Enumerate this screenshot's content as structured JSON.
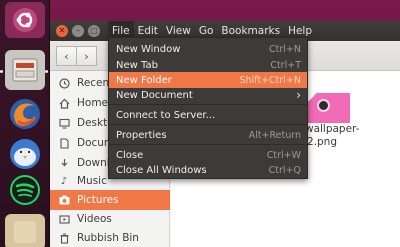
{
  "menubar": {
    "items": [
      "File",
      "Edit",
      "View",
      "Go",
      "Bookmarks",
      "Help"
    ]
  },
  "sidebar": {
    "items": [
      {
        "label": "Recent",
        "icon": "clock-icon"
      },
      {
        "label": "Home",
        "icon": "home-icon"
      },
      {
        "label": "Desktop",
        "icon": "desktop-icon"
      },
      {
        "label": "Documents",
        "icon": "document-icon"
      },
      {
        "label": "Downloads",
        "icon": "download-icon"
      },
      {
        "label": "Music",
        "icon": "music-icon"
      },
      {
        "label": "Pictures",
        "icon": "camera-icon"
      },
      {
        "label": "Videos",
        "icon": "video-icon"
      },
      {
        "label": "Rubbish Bin",
        "icon": "trash-icon"
      }
    ],
    "selected": "Pictures"
  },
  "file_menu": {
    "items": [
      {
        "label": "New Window",
        "accel": "Ctrl+N"
      },
      {
        "label": "New Tab",
        "accel": "Ctrl+T"
      },
      {
        "label": "New Folder",
        "accel": "Shift+Ctrl+N"
      },
      {
        "label": "New Document",
        "accel": "›"
      },
      {
        "label": "Connect to Server...",
        "accel": ""
      },
      {
        "label": "Properties",
        "accel": "Alt+Return"
      },
      {
        "label": "Close",
        "accel": "Ctrl+W"
      },
      {
        "label": "Close All Windows",
        "accel": "Ctrl+Q"
      }
    ],
    "highlighted": "New Folder"
  },
  "content": {
    "file_label_line1": "me-wallpaper-",
    "file_label_line2": "2.png"
  },
  "colors": {
    "accent": "#f07746",
    "menu_bg": "#3c3b37",
    "titlebar": "#3a3835",
    "desktop": "#6a1540"
  }
}
